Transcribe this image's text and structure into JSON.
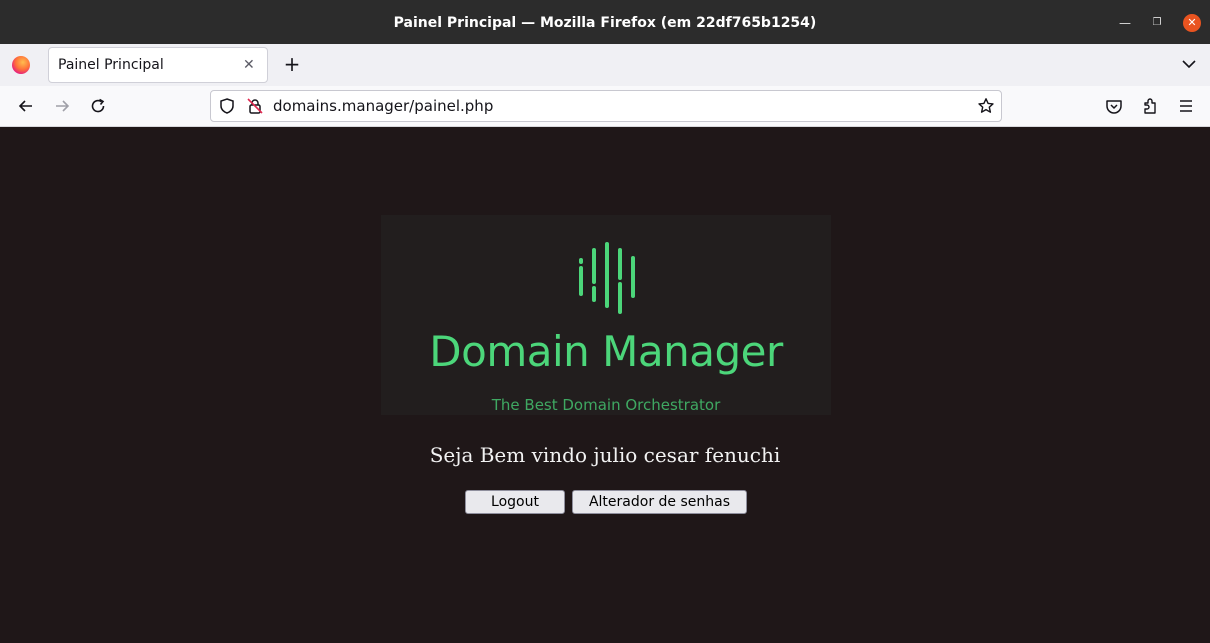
{
  "window": {
    "title": "Painel Principal — Mozilla Firefox (em 22df765b1254)",
    "controls": [
      "minimize-icon",
      "maximize-icon",
      "close-icon"
    ]
  },
  "tabs": [
    {
      "label": "Painel Principal",
      "close": "✕"
    }
  ],
  "newtab_label": "+",
  "urlbar": {
    "url": "domains.manager/painel.php"
  },
  "logo": {
    "title": "Domain Manager",
    "tagline": "The Best Domain Orchestrator"
  },
  "welcome_text": "Seja Bem vindo julio cesar fenuchi",
  "buttons": {
    "logout": "Logout",
    "password_changer": "Alterador de senhas"
  },
  "colors": {
    "page_background": "#1f1718",
    "logo_box": "#221e1e",
    "brand_green": "#4cd67a",
    "tagline_green": "#3fa862",
    "close_button": "#e95420"
  }
}
